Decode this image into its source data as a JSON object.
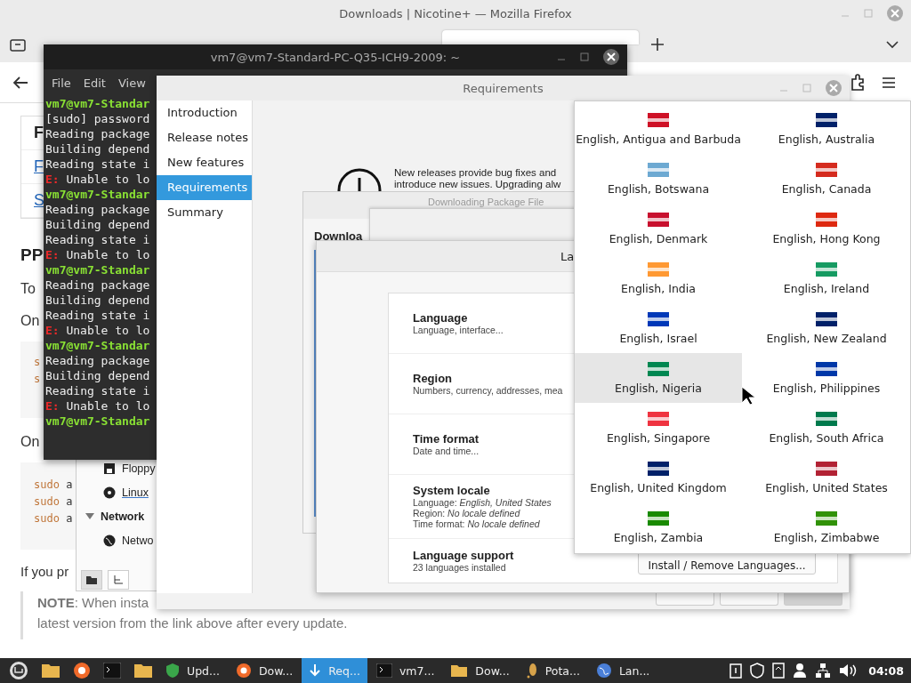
{
  "firefox": {
    "title": "Downloads | Nicotine+ — Mozilla Firefox",
    "page": {
      "table": [
        {
          "text": "F",
          "link": false
        },
        {
          "text": "F",
          "link": true
        },
        {
          "text": "S",
          "link": true
        }
      ],
      "heading": "PP",
      "paragraphs": [
        "To",
        "On"
      ],
      "code1": [
        {
          "cmd": "s"
        },
        {
          "cmd": "s"
        }
      ],
      "paragraph2": "On",
      "code2": [
        {
          "cmd": "sudo",
          "rest": "a"
        },
        {
          "cmd": "sudo",
          "rest": "a"
        },
        {
          "cmd": "sudo",
          "rest": "a"
        }
      ],
      "paragraph3": "If you pr",
      "note": [
        "**NOTE**: When insta",
        "latest version from the link above after every update."
      ]
    }
  },
  "terminal": {
    "title": "vm7@vm7-Standard-PC-Q35-ICH9-2009: ~",
    "menu": [
      "File",
      "Edit",
      "View"
    ],
    "lines": [
      {
        "kind": "prompt",
        "text": "vm7@vm7-Standar"
      },
      {
        "kind": "output",
        "text": "[sudo] password"
      },
      {
        "kind": "output",
        "text": "Reading package"
      },
      {
        "kind": "output",
        "text": "Building depend"
      },
      {
        "kind": "output",
        "text": "Reading state i"
      },
      {
        "kind": "error",
        "tag": "E:",
        "text": "Unable to lo"
      },
      {
        "kind": "prompt",
        "text": "vm7@vm7-Standar"
      },
      {
        "kind": "output",
        "text": "Reading package"
      },
      {
        "kind": "output",
        "text": "Building depend"
      },
      {
        "kind": "output",
        "text": "Reading state i"
      },
      {
        "kind": "error",
        "tag": "E:",
        "text": "Unable to lo"
      },
      {
        "kind": "prompt",
        "text": "vm7@vm7-Standar"
      },
      {
        "kind": "output",
        "text": "Reading package"
      },
      {
        "kind": "output",
        "text": "Building depend"
      },
      {
        "kind": "output",
        "text": "Reading state i"
      },
      {
        "kind": "error",
        "tag": "E:",
        "text": "Unable to lo"
      },
      {
        "kind": "prompt",
        "text": "vm7@vm7-Standar"
      },
      {
        "kind": "output",
        "text": "Reading package"
      },
      {
        "kind": "output",
        "text": "Building depend"
      },
      {
        "kind": "output",
        "text": "Reading state i"
      },
      {
        "kind": "error",
        "tag": "E:",
        "text": "Unable to lo"
      },
      {
        "kind": "prompt",
        "text": "vm7@vm7-Standar"
      }
    ]
  },
  "files": {
    "items": [
      {
        "kind": "floppy",
        "label": "Floppy",
        "underlined": false
      },
      {
        "kind": "disc",
        "label": "Linux",
        "underlined": true
      },
      {
        "kind": "header",
        "label": "Network",
        "underlined": false
      },
      {
        "kind": "network",
        "label": "Netwo",
        "underlined": false
      }
    ]
  },
  "installer": {
    "title": "Requirements",
    "steps": [
      {
        "label": "Introduction",
        "selected": false
      },
      {
        "label": "Release notes",
        "selected": false
      },
      {
        "label": "New features",
        "selected": false
      },
      {
        "label": "Requirements",
        "selected": true
      },
      {
        "label": "Summary",
        "selected": false
      }
    ],
    "notice": [
      "New releases provide bug fixes and",
      "introduce new issues. Upgrading alw"
    ]
  },
  "download_dialog": {
    "title": "Downloading Package File",
    "heading": "Downloa"
  },
  "language_window": {
    "title": "La",
    "rows": [
      {
        "title": "Language",
        "lines": [
          "Language, interface..."
        ]
      },
      {
        "title": "Region",
        "lines": [
          "Numbers, currency, addresses, mea"
        ]
      },
      {
        "title": "Time format",
        "lines": [
          "Date and time..."
        ]
      },
      {
        "title": "System locale",
        "lines": [
          "Language: *English, United States*",
          "Region: *No locale defined*",
          "Time format: *No locale defined*"
        ]
      },
      {
        "title": "Language support",
        "lines": [
          "23 languages installed"
        ]
      }
    ],
    "install_button": "Install / Remove Languages..."
  },
  "language_popover": {
    "items": [
      {
        "label": "English, Antigua and Barbuda",
        "color": "#ce1126",
        "selected": false
      },
      {
        "label": "English, Australia",
        "color": "#012169",
        "selected": false
      },
      {
        "label": "English, Botswana",
        "color": "#6da9d2",
        "selected": false
      },
      {
        "label": "English, Canada",
        "color": "#d52b1e",
        "selected": false
      },
      {
        "label": "English, Denmark",
        "color": "#c8102e",
        "selected": false
      },
      {
        "label": "English, Hong Kong",
        "color": "#de2910",
        "selected": false
      },
      {
        "label": "English, India",
        "color": "#ff9933",
        "selected": false
      },
      {
        "label": "English, Ireland",
        "color": "#169b62",
        "selected": false
      },
      {
        "label": "English, Israel",
        "color": "#0038b8",
        "selected": false
      },
      {
        "label": "English, New Zealand",
        "color": "#012169",
        "selected": false
      },
      {
        "label": "English, Nigeria",
        "color": "#008751",
        "selected": true
      },
      {
        "label": "English, Philippines",
        "color": "#0038a8",
        "selected": false
      },
      {
        "label": "English, Singapore",
        "color": "#ef3340",
        "selected": false
      },
      {
        "label": "English, South Africa",
        "color": "#007a4d",
        "selected": false
      },
      {
        "label": "English, United Kingdom",
        "color": "#012169",
        "selected": false
      },
      {
        "label": "English, United States",
        "color": "#b22234",
        "selected": false
      },
      {
        "label": "English, Zambia",
        "color": "#198a00",
        "selected": false
      },
      {
        "label": "English, Zimbabwe",
        "color": "#319208",
        "selected": false
      }
    ]
  },
  "taskbar": {
    "tasks": [
      {
        "kind": "shield",
        "label": "Upd...",
        "active": false
      },
      {
        "kind": "browser",
        "label": "Dow...",
        "active": false
      },
      {
        "kind": "download",
        "label": "Req...",
        "active": true
      },
      {
        "kind": "terminal",
        "label": "vm7...",
        "active": false
      },
      {
        "kind": "folder",
        "label": "Dow...",
        "active": false
      },
      {
        "kind": "potato",
        "label": "Pota...",
        "active": false
      },
      {
        "kind": "globe",
        "label": "Lan...",
        "active": false
      }
    ],
    "clock": "04:08"
  }
}
